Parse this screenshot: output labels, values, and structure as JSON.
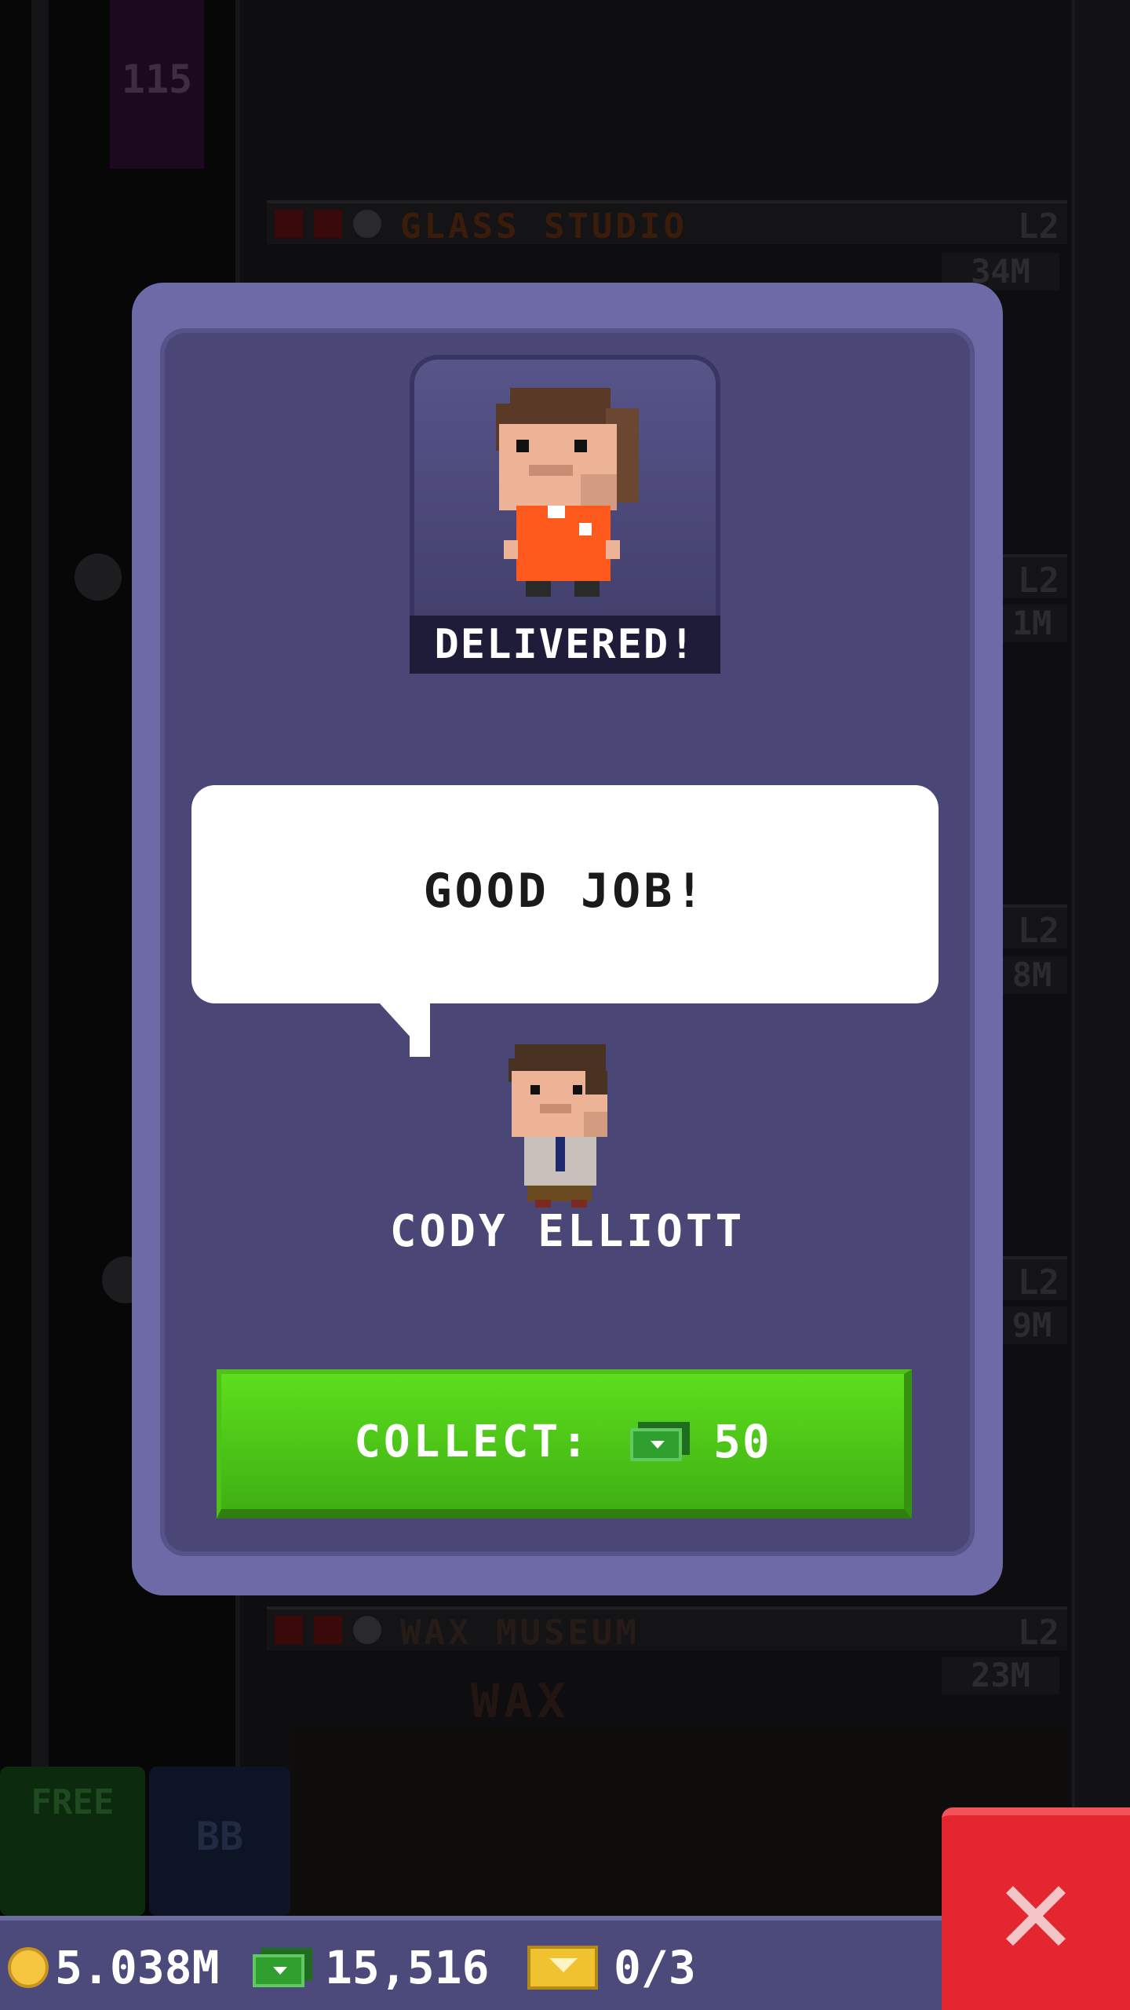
{
  "background": {
    "elevator_floor_number": "115",
    "floors": [
      {
        "name": "GLASS STUDIO",
        "level": "L2",
        "tag": "34M"
      },
      {
        "name": "",
        "level": "L2",
        "tag": "1M"
      },
      {
        "name": "",
        "level": "L2",
        "tag": "8M"
      },
      {
        "name": "",
        "level": "L2",
        "tag": "9M"
      },
      {
        "name": "WAX MUSEUM",
        "level": "L2",
        "tag": "23M"
      }
    ],
    "wax_sign": "WAX",
    "free_button_label": "FREE",
    "bb_button_label": "BB"
  },
  "modal": {
    "status_label": "DELIVERED!",
    "speech_text": "GOOD JOB!",
    "customer_name": "CODY ELLIOTT",
    "collect_label": "COLLECT:",
    "collect_amount": "50"
  },
  "status_bar": {
    "coins": "5.038M",
    "bux": "15,516",
    "tickets": "0/3"
  },
  "colors": {
    "modal_frame": "#6e6aa8",
    "modal_inner": "#4a4777",
    "collect_green": "#4fc218",
    "close_red": "#e3262f",
    "status_bar": "#4b4a7a"
  },
  "icons": {
    "coin": "coin-icon",
    "bux": "tower-bux-icon",
    "ticket": "vip-ticket-icon",
    "close": "close-icon"
  }
}
